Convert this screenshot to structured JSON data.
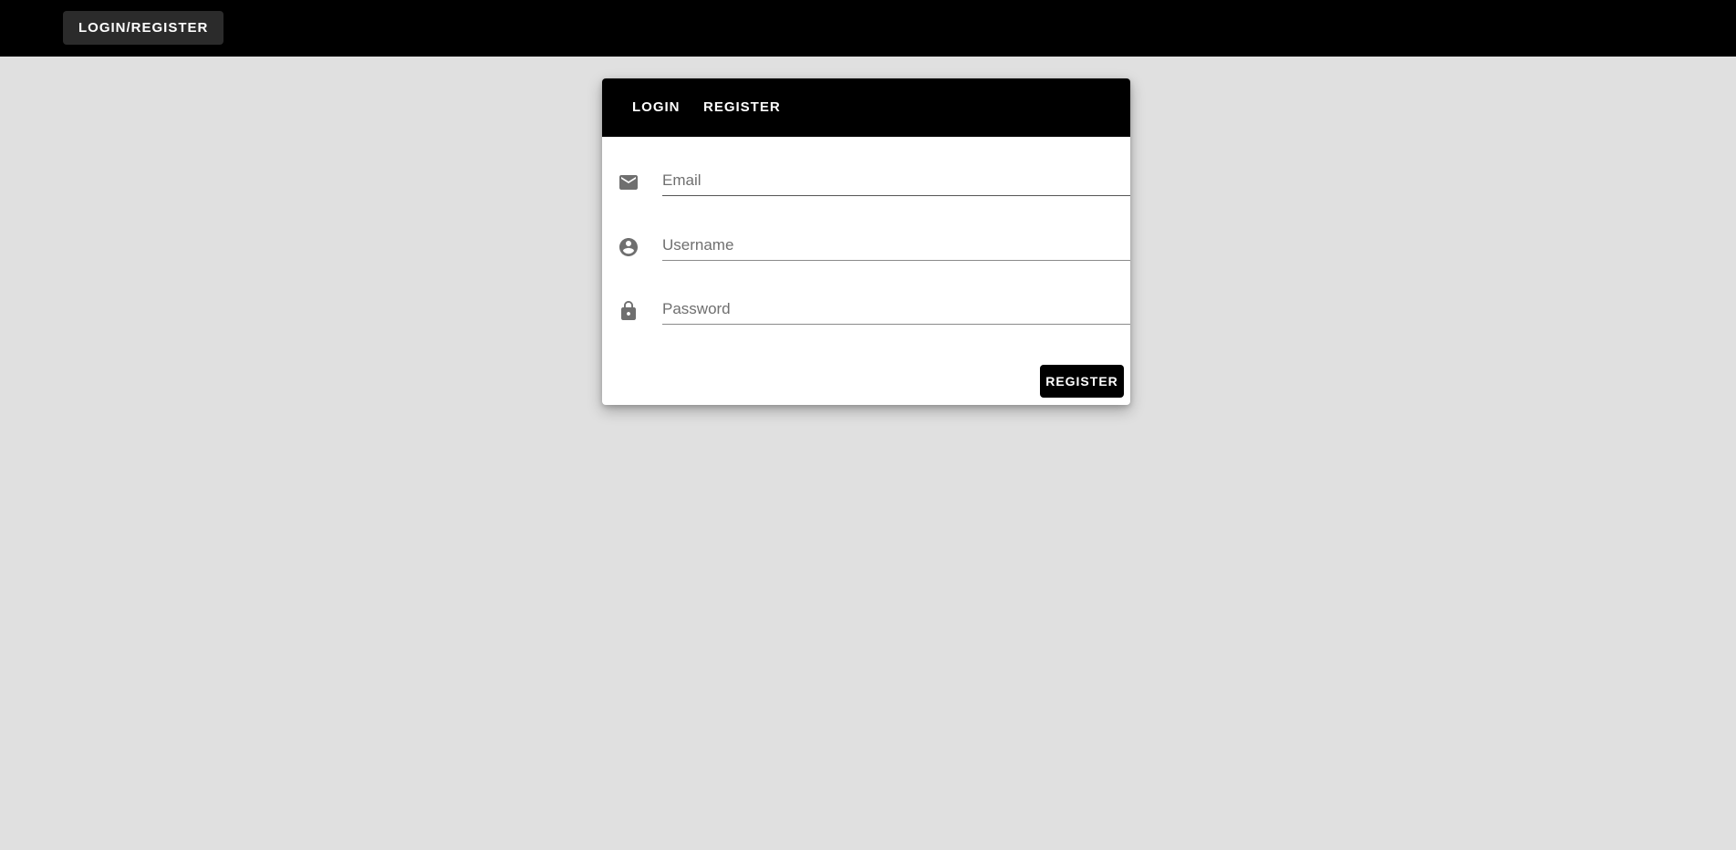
{
  "topbar": {
    "login_register_label": "LOGIN/REGISTER"
  },
  "card": {
    "tabs": [
      {
        "label": "LOGIN"
      },
      {
        "label": "REGISTER"
      }
    ],
    "fields": {
      "email": {
        "placeholder": "Email",
        "value": "",
        "icon": "email-icon"
      },
      "username": {
        "placeholder": "Username",
        "value": "",
        "icon": "account-circle-icon"
      },
      "password": {
        "placeholder": "Password",
        "value": "",
        "icon": "lock-icon"
      }
    },
    "submit_label": "REGISTER"
  },
  "colors": {
    "topbar_bg": "#000000",
    "page_bg": "#e0e0e0",
    "card_bg": "#ffffff",
    "button_bg": "#000000",
    "icon": "#6f6f6f"
  }
}
